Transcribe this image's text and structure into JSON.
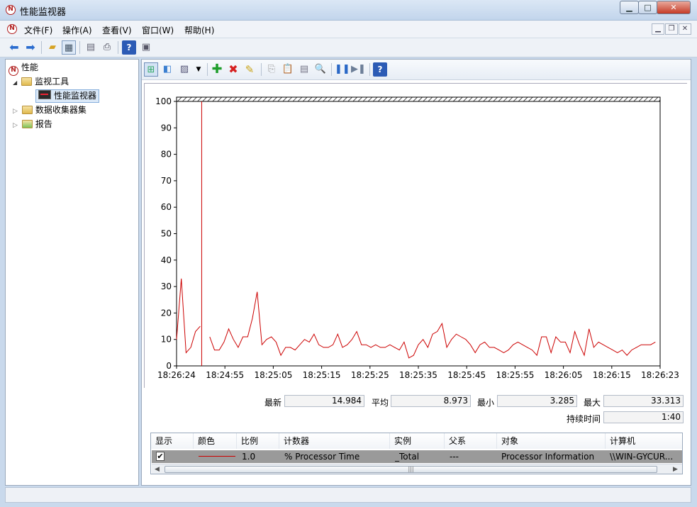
{
  "window": {
    "title": "性能监视器"
  },
  "menu": {
    "items": [
      "文件(F)",
      "操作(A)",
      "查看(V)",
      "窗口(W)",
      "帮助(H)"
    ]
  },
  "tree": {
    "root": "性能",
    "monitor_tools": "监视工具",
    "perf_monitor": "性能监视器",
    "data_collector_sets": "数据收集器集",
    "reports": "报告"
  },
  "stats": {
    "latest_label": "最新",
    "latest": "14.984",
    "average_label": "平均",
    "average": "8.973",
    "min_label": "最小",
    "min": "3.285",
    "max_label": "最大",
    "max": "33.313",
    "duration_label": "持续时间",
    "duration": "1:40"
  },
  "legend": {
    "headers": [
      "显示",
      "颜色",
      "比例",
      "计数器",
      "实例",
      "父系",
      "对象",
      "计算机"
    ],
    "row": {
      "checked": "✔",
      "scale": "1.0",
      "counter": "% Processor Time",
      "instance": "_Total",
      "parent": "---",
      "object": "Processor Information",
      "computer": "\\\\WIN-GYCUR..."
    },
    "line_color": "#cc0000"
  },
  "chart_data": {
    "type": "line",
    "ylim": [
      0,
      100
    ],
    "yticks": [
      0,
      10,
      20,
      30,
      40,
      50,
      60,
      70,
      80,
      90,
      100
    ],
    "xtick_labels": [
      "18:26:24",
      "18:24:55",
      "18:25:05",
      "18:25:15",
      "18:25:25",
      "18:25:35",
      "18:25:45",
      "18:25:55",
      "18:26:05",
      "18:26:15",
      "18:26:23"
    ],
    "series": [
      {
        "color": "#cc0000",
        "segment1": [
          10,
          33,
          5,
          7,
          13,
          15
        ],
        "segment2": [
          11,
          6,
          6,
          9,
          14,
          10,
          7,
          11,
          11,
          18,
          28,
          8,
          10,
          11,
          9,
          4,
          7,
          7,
          6,
          8,
          10,
          9,
          12,
          8,
          7,
          7,
          8,
          12,
          7,
          8,
          10,
          13,
          8,
          8,
          7,
          8,
          7,
          7,
          8,
          7,
          6,
          9,
          3,
          4,
          8,
          10,
          7,
          12,
          13,
          16,
          7,
          10,
          12,
          11,
          10,
          8,
          5,
          8,
          9,
          7,
          7,
          6,
          5,
          6,
          8,
          9,
          8,
          7,
          6,
          4,
          11,
          11,
          5,
          11,
          9,
          9,
          5,
          13,
          8,
          4,
          14,
          7,
          9,
          8,
          7,
          6,
          5,
          6,
          4,
          6,
          7,
          8,
          8,
          8,
          9
        ]
      }
    ]
  }
}
